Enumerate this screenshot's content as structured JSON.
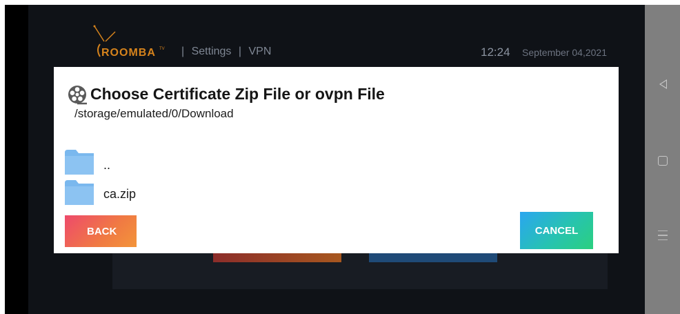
{
  "header": {
    "logo_text": "ROOMBA",
    "logo_sup": "TV",
    "sep1": "|",
    "settings": "Settings",
    "sep2": "|",
    "vpn": "VPN",
    "time": "12:24",
    "date": "September 04,2021"
  },
  "dialog": {
    "title": "Choose Certificate Zip File or ovpn File",
    "path": "/storage/emulated/0/Download",
    "files": [
      {
        "name": "..",
        "icon": "folder-icon"
      },
      {
        "name": "ca.zip",
        "icon": "folder-icon"
      }
    ],
    "back_label": "BACK",
    "cancel_label": "CANCEL"
  },
  "colors": {
    "folder": "#7ab8ee",
    "back_gradient": [
      "#ee4a6b",
      "#f3953a"
    ],
    "cancel_gradient": [
      "#2aa6f0",
      "#2bd07f"
    ],
    "logo": "#d6831c"
  },
  "system_nav": {
    "icons": [
      "back-triangle-icon",
      "home-square-icon",
      "recent-apps-icon"
    ]
  }
}
